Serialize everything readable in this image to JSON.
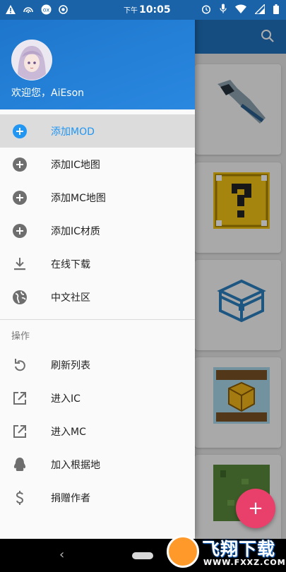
{
  "status_bar": {
    "am_pm": "下午",
    "time": "10:05"
  },
  "drawer": {
    "welcome": "欢迎您，AiEson",
    "items": [
      {
        "label": "添加MOD",
        "icon": "add-circle-icon",
        "active": true
      },
      {
        "label": "添加IC地图",
        "icon": "add-circle-icon"
      },
      {
        "label": "添加MC地图",
        "icon": "add-circle-icon"
      },
      {
        "label": "添加IC材质",
        "icon": "add-circle-icon"
      },
      {
        "label": "在线下载",
        "icon": "download-icon"
      },
      {
        "label": "中文社区",
        "icon": "globe-icon"
      }
    ],
    "section_title": "操作",
    "actions": [
      {
        "label": "刷新列表",
        "icon": "refresh-icon"
      },
      {
        "label": "进入IC",
        "icon": "open-external-icon"
      },
      {
        "label": "进入MC",
        "icon": "open-external-icon"
      },
      {
        "label": "加入根据地",
        "icon": "qq-penguin-icon"
      },
      {
        "label": "捐赠作者",
        "icon": "dollar-icon"
      }
    ]
  },
  "fab": {
    "label": "+"
  },
  "watermark": {
    "brand": "飞翔下载",
    "site": "WWW.FXXZ.COM"
  },
  "colors": {
    "appbar": "#2172bd",
    "accent": "#2196f3",
    "fab": "#e83f6b"
  }
}
